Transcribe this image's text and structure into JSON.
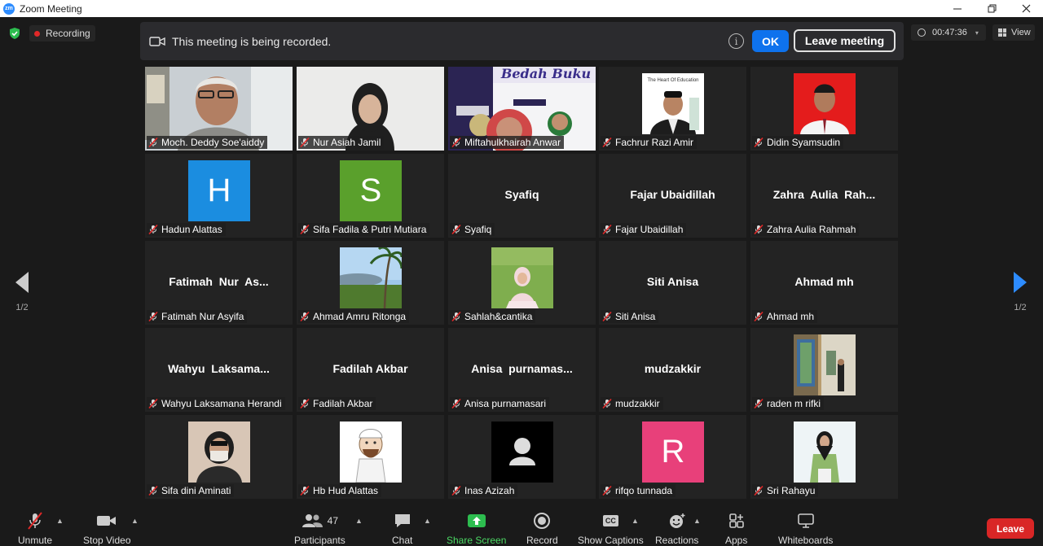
{
  "window": {
    "title": "Zoom Meeting",
    "app_icon": "zm"
  },
  "topbar": {
    "recording_label": "Recording",
    "banner_message": "This meeting is being recorded.",
    "ok_label": "OK",
    "leave_meeting_label": "Leave meeting",
    "elapsed_time": "00:47:36",
    "view_label": "View"
  },
  "gallery": {
    "page_indicator": "1/2",
    "tiles": [
      {
        "name": "Moch. Deddy Soe'aiddy",
        "display": "",
        "active": true,
        "kind": "video-man"
      },
      {
        "name": "Nur Asiah Jamil",
        "display": "",
        "kind": "video-hijab"
      },
      {
        "name": "Miftahulkhairah Anwar",
        "display": "",
        "kind": "video-poster"
      },
      {
        "name": "Fachrur Razi Amir",
        "display": "",
        "kind": "photo-man-cap"
      },
      {
        "name": "Didin Syamsudin",
        "display": "",
        "kind": "photo-red"
      },
      {
        "name": "Hadun Alattas",
        "display": "",
        "kind": "letter",
        "letter": "H",
        "color": "#1b8de0"
      },
      {
        "name": "Sifa Fadila & Putri Mutiara",
        "display": "",
        "kind": "letter",
        "letter": "S",
        "color": "#5aa02c"
      },
      {
        "name": "Syafiq",
        "display": "Syafiq",
        "kind": "text"
      },
      {
        "name": "Fajar Ubaidillah",
        "display": "Fajar Ubaidillah",
        "kind": "text"
      },
      {
        "name": "Zahra Aulia Rahmah",
        "display": "Zahra  Aulia  Rah...",
        "kind": "text"
      },
      {
        "name": "Fatimah Nur Asyifa",
        "display": "Fatimah  Nur  As...",
        "kind": "text"
      },
      {
        "name": "Ahmad Amru Ritonga",
        "display": "",
        "kind": "photo-palm"
      },
      {
        "name": "Sahlah&cantika",
        "display": "",
        "kind": "photo-field"
      },
      {
        "name": "Siti Anisa",
        "display": "Siti Anisa",
        "kind": "text"
      },
      {
        "name": "Ahmad mh",
        "display": "Ahmad mh",
        "kind": "text"
      },
      {
        "name": "Wahyu Laksamana Herandi",
        "display": "Wahyu  Laksama...",
        "kind": "text"
      },
      {
        "name": "Fadilah Akbar",
        "display": "Fadilah Akbar",
        "kind": "text"
      },
      {
        "name": "Anisa purnamasari",
        "display": "Anisa  purnamas...",
        "kind": "text"
      },
      {
        "name": "mudzakkir",
        "display": "mudzakkir",
        "kind": "text"
      },
      {
        "name": "raden m rifki",
        "display": "",
        "kind": "photo-room"
      },
      {
        "name": "Sifa dini Aminati",
        "display": "",
        "kind": "photo-mask"
      },
      {
        "name": "Hb Hud Alattas",
        "display": "",
        "kind": "photo-cartoon"
      },
      {
        "name": "Inas Azizah",
        "display": "",
        "kind": "photo-blank"
      },
      {
        "name": "rifqo tunnada",
        "display": "",
        "kind": "letter",
        "letter": "R",
        "color": "#e8407a"
      },
      {
        "name": "Sri Rahayu",
        "display": "",
        "kind": "photo-green"
      }
    ]
  },
  "toolbar": {
    "unmute": "Unmute",
    "stop_video": "Stop Video",
    "participants": "Participants",
    "participants_count": "47",
    "chat": "Chat",
    "share_screen": "Share Screen",
    "record": "Record",
    "show_captions": "Show Captions",
    "captions_icon_text": "CC",
    "reactions": "Reactions",
    "apps": "Apps",
    "whiteboards": "Whiteboards",
    "leave": "Leave"
  }
}
